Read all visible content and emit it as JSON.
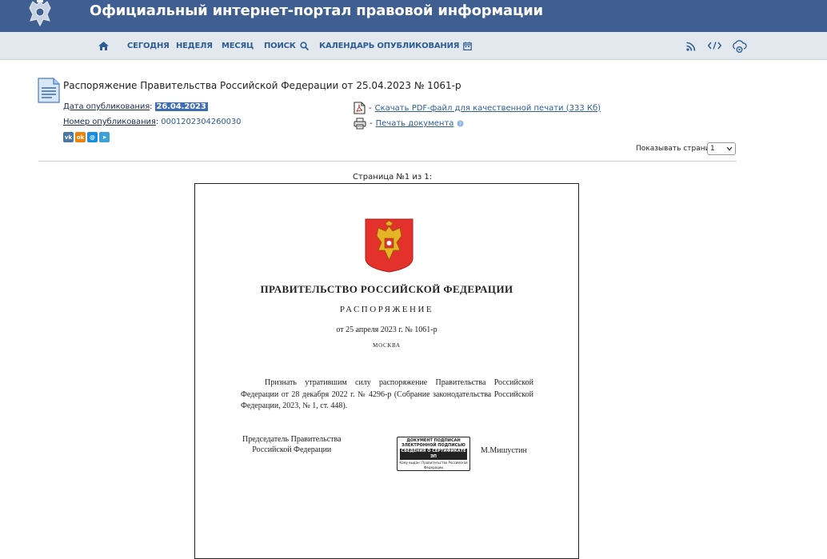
{
  "header": {
    "portal_title": "Официальный интернет-портал правовой информации"
  },
  "nav": {
    "home_icon": "home-icon",
    "items": [
      {
        "label": "СЕГОДНЯ"
      },
      {
        "label": "НЕДЕЛЯ"
      },
      {
        "label": "МЕСЯЦ"
      },
      {
        "label": "ПОИСК",
        "icon": "search-icon"
      },
      {
        "label": "КАЛЕНДАРЬ ОПУБЛИКОВАНИЯ",
        "icon": "calendar-icon"
      }
    ],
    "right_icons": [
      "rss-icon",
      "code-icon",
      "settings-icon"
    ]
  },
  "document": {
    "title": "Распоряжение Правительства Российской Федерации от 25.04.2023 № 1061-р",
    "pub_date_label": "Дата опубликования",
    "pub_date": "26.04.2023",
    "pub_number_label": "Номер опубликования",
    "pub_number": "0001202304260030",
    "share": [
      "vk",
      "odnoklassniki",
      "mail-ru",
      "telegram"
    ],
    "download_pdf": "Скачать PDF-файл для качественной печати (333 Кб)",
    "print": "Печать документа",
    "dash": "-",
    "pages_label": "Показывать страниц:",
    "pages_value": "1",
    "page_indicator": "Страница №1 из 1:"
  },
  "page": {
    "gov": "ПРАВИТЕЛЬСТВО РОССИЙСКОЙ ФЕДЕРАЦИИ",
    "kind": "РАСПОРЯЖЕНИЕ",
    "date_line": "от 25 апреля 2023 г.  № 1061-р",
    "city": "МОСКВА",
    "body": "Признать утратившим силу распоряжение Правительства Российской Федерации от 28 декабря 2022 г. № 4296-р (Собрание законодательства Российской Федерации, 2023, № 1, ст. 448).",
    "sign_line1": "Председатель Правительства",
    "sign_line2": "Российской Федерации",
    "stamp_line1": "ДОКУМЕНТ ПОДПИСАН",
    "stamp_line2": "ЭЛЕКТРОННОЙ ПОДПИСЬЮ",
    "stamp_line3": "СВЕДЕНИЯ О СЕРТИФИКАТЕ ЭП",
    "stamp_line4": "Кому выдан: Правительство Российской Федерации",
    "signer": "М.Мишустин"
  },
  "colors": {
    "header": "#3f5f93",
    "nav": "#e3e8ee",
    "link": "#2d5d94"
  }
}
